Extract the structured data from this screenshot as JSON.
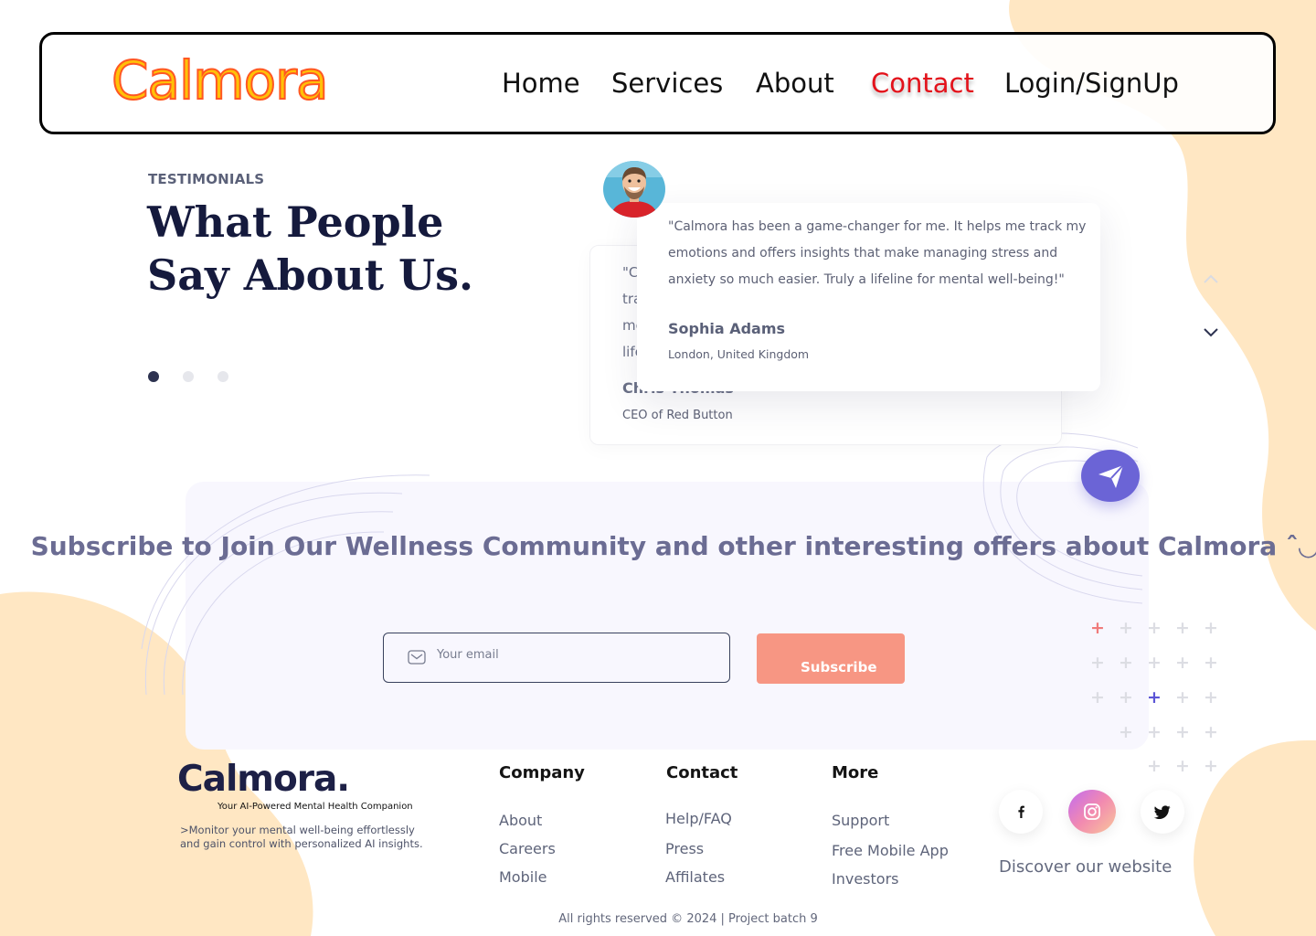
{
  "colors": {
    "accent": "#e3121b",
    "logo_fill": "#ffc107",
    "logo_stroke": "#ff5722",
    "blob": "#ffe7c3",
    "subscribe_button": "#f79683",
    "badge": "#6b64d6",
    "panel": "#f8f7fe"
  },
  "nav": {
    "logo": "Calmora",
    "links": [
      "Home",
      "Services",
      "About",
      "Contact",
      "Login/SignUp"
    ],
    "active": "Contact"
  },
  "testimonials": {
    "eyebrow": "TESTIMONIALS",
    "title": "What People Say About Us.",
    "slide_count": 3,
    "active_slide": 1,
    "front": {
      "quote": "\"Calmora has been a game-changer for me. It helps me track my emotions and offers insights that make managing stress and anxiety so much easier. Truly a lifeline for mental well-being!\"",
      "name": "Sophia Adams",
      "location": "London, United Kingdom"
    },
    "back": {
      "quote_fragments": [
        "\"C",
        "tra",
        "me",
        "life"
      ],
      "name": "Chris Thomas",
      "role": "CEO of Red Button"
    },
    "arrows": [
      "chevron-up-icon",
      "chevron-down-icon"
    ]
  },
  "subscribe": {
    "title": "Subscribe to Join Our Wellness Community and other interesting offers about Calmora ˆ◡ˆ",
    "email_placeholder": "Your email",
    "button_label": "Subscribe",
    "badge_icon": "send-icon"
  },
  "footer": {
    "logo": "Calmora.",
    "tagline": "Your AI-Powered Mental Health Companion",
    "description": ">Monitor your mental well-being effortlessly and gain control with personalized AI insights.",
    "columns": [
      {
        "heading": "Company",
        "links": [
          "About",
          "Careers",
          "Mobile"
        ]
      },
      {
        "heading": "Contact",
        "links": [
          "Help/FAQ",
          "Press",
          "Affilates"
        ]
      },
      {
        "heading": "More",
        "links": [
          "Support",
          "Free Mobile App",
          "Investors"
        ]
      }
    ],
    "social": [
      "facebook-icon",
      "instagram-icon",
      "twitter-icon"
    ],
    "discover": "Discover our website",
    "copyright": "All rights reserved © 2024 | Project batch 9"
  }
}
